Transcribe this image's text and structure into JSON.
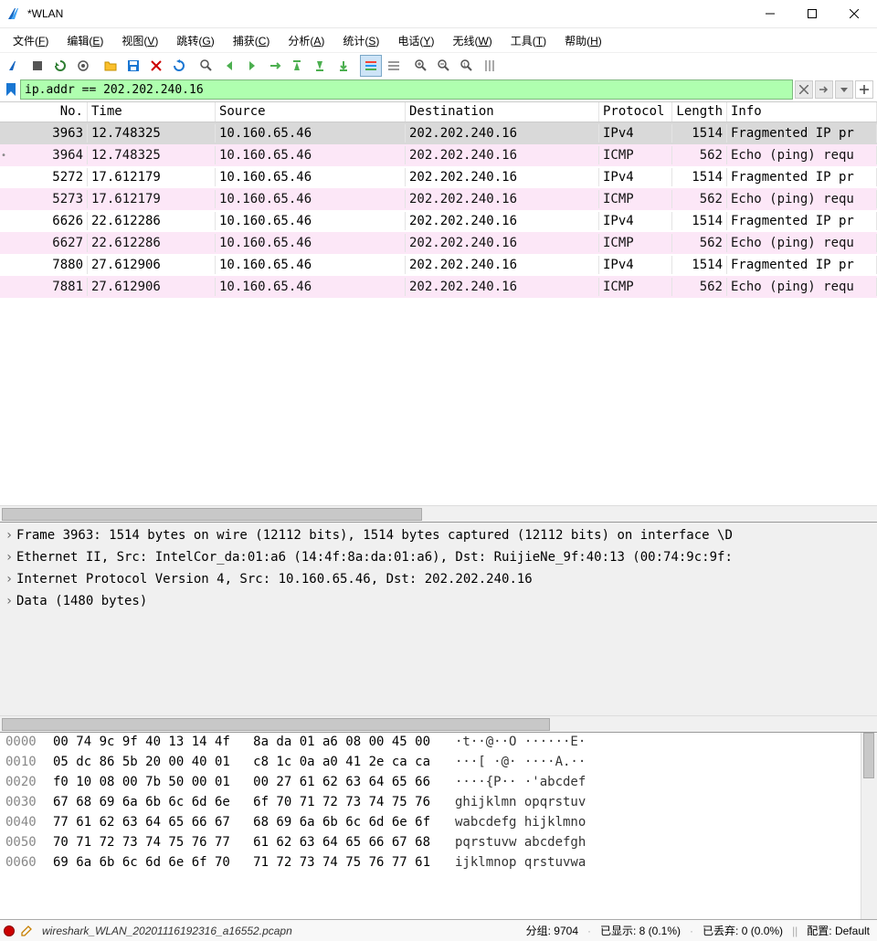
{
  "title": "*WLAN",
  "menus": [
    "文件(F)",
    "编辑(E)",
    "视图(V)",
    "跳转(G)",
    "捕获(C)",
    "分析(A)",
    "统计(S)",
    "电话(Y)",
    "无线(W)",
    "工具(T)",
    "帮助(H)"
  ],
  "filter_value": "ip.addr == 202.202.240.16",
  "columns": [
    "No.",
    "Time",
    "Source",
    "Destination",
    "Protocol",
    "Length",
    "Info"
  ],
  "packets": [
    {
      "no": "3963",
      "time": "12.748325",
      "src": "10.160.65.46",
      "dst": "202.202.240.16",
      "proto": "IPv4",
      "len": "1514",
      "info": "Fragmented IP pr",
      "cls": "sel",
      "mark": ""
    },
    {
      "no": "3964",
      "time": "12.748325",
      "src": "10.160.65.46",
      "dst": "202.202.240.16",
      "proto": "ICMP",
      "len": "562",
      "info": "Echo (ping) requ",
      "cls": "pink",
      "mark": "•"
    },
    {
      "no": "5272",
      "time": "17.612179",
      "src": "10.160.65.46",
      "dst": "202.202.240.16",
      "proto": "IPv4",
      "len": "1514",
      "info": "Fragmented IP pr",
      "cls": "white",
      "mark": ""
    },
    {
      "no": "5273",
      "time": "17.612179",
      "src": "10.160.65.46",
      "dst": "202.202.240.16",
      "proto": "ICMP",
      "len": "562",
      "info": "Echo (ping) requ",
      "cls": "pink",
      "mark": ""
    },
    {
      "no": "6626",
      "time": "22.612286",
      "src": "10.160.65.46",
      "dst": "202.202.240.16",
      "proto": "IPv4",
      "len": "1514",
      "info": "Fragmented IP pr",
      "cls": "white",
      "mark": ""
    },
    {
      "no": "6627",
      "time": "22.612286",
      "src": "10.160.65.46",
      "dst": "202.202.240.16",
      "proto": "ICMP",
      "len": "562",
      "info": "Echo (ping) requ",
      "cls": "pink",
      "mark": ""
    },
    {
      "no": "7880",
      "time": "27.612906",
      "src": "10.160.65.46",
      "dst": "202.202.240.16",
      "proto": "IPv4",
      "len": "1514",
      "info": "Fragmented IP pr",
      "cls": "white",
      "mark": ""
    },
    {
      "no": "7881",
      "time": "27.612906",
      "src": "10.160.65.46",
      "dst": "202.202.240.16",
      "proto": "ICMP",
      "len": "562",
      "info": "Echo (ping) requ",
      "cls": "pink",
      "mark": ""
    }
  ],
  "details": [
    "Frame 3963: 1514 bytes on wire (12112 bits), 1514 bytes captured (12112 bits) on interface \\D",
    "Ethernet II, Src: IntelCor_da:01:a6 (14:4f:8a:da:01:a6), Dst: RuijieNe_9f:40:13 (00:74:9c:9f:",
    "Internet Protocol Version 4, Src: 10.160.65.46, Dst: 202.202.240.16",
    "Data (1480 bytes)"
  ],
  "hex": [
    {
      "off": "0000",
      "b": "00 74 9c 9f 40 13 14 4f   8a da 01 a6 08 00 45 00",
      "a": "·t··@··O ······E·"
    },
    {
      "off": "0010",
      "b": "05 dc 86 5b 20 00 40 01   c8 1c 0a a0 41 2e ca ca",
      "a": "···[ ·@· ····A.··"
    },
    {
      "off": "0020",
      "b": "f0 10 08 00 7b 50 00 01   00 27 61 62 63 64 65 66",
      "a": "····{P·· ·'abcdef"
    },
    {
      "off": "0030",
      "b": "67 68 69 6a 6b 6c 6d 6e   6f 70 71 72 73 74 75 76",
      "a": "ghijklmn opqrstuv"
    },
    {
      "off": "0040",
      "b": "77 61 62 63 64 65 66 67   68 69 6a 6b 6c 6d 6e 6f",
      "a": "wabcdefg hijklmno"
    },
    {
      "off": "0050",
      "b": "70 71 72 73 74 75 76 77   61 62 63 64 65 66 67 68",
      "a": "pqrstuvw abcdefgh"
    },
    {
      "off": "0060",
      "b": "69 6a 6b 6c 6d 6e 6f 70   71 72 73 74 75 76 77 61",
      "a": "ijklmnop qrstuvwa"
    }
  ],
  "status": {
    "file": "wireshark_WLAN_20201116192316_a16552.pcapn",
    "packets": "分组: 9704",
    "displayed": "已显示: 8 (0.1%)",
    "dropped": "已丢弃: 0 (0.0%)",
    "profile": "配置: Default"
  }
}
